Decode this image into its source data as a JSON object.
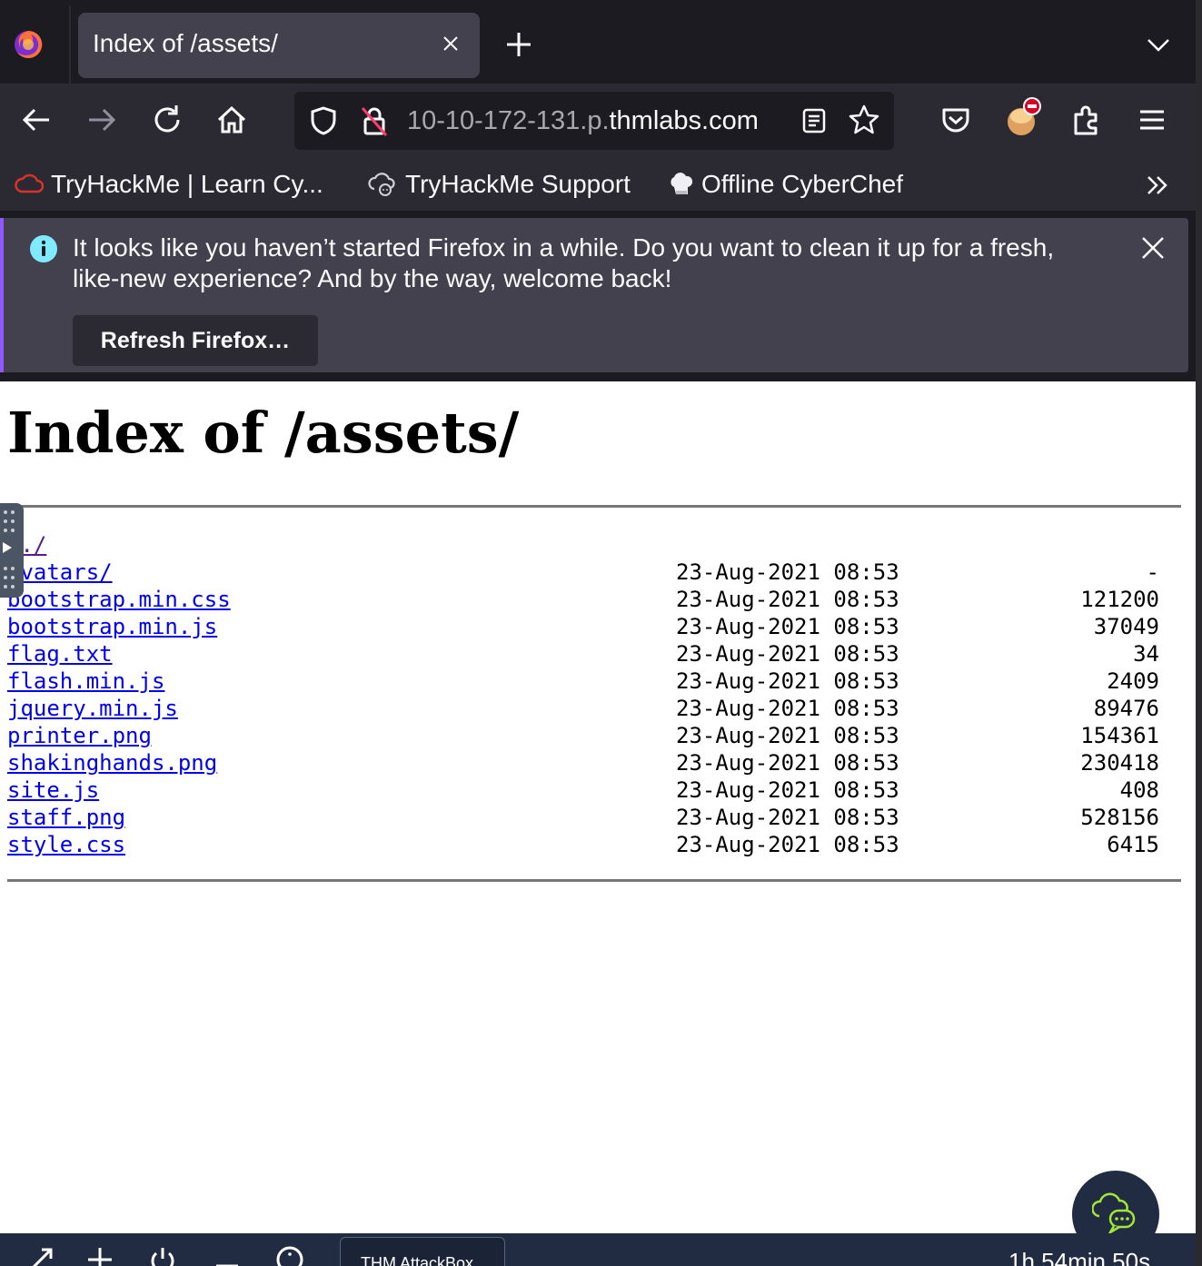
{
  "browser": {
    "tab_title": "Index of /assets/",
    "url_prefix": "10-10-172-131.p.",
    "url_domain": "thmlabs.com",
    "bookmarks": [
      {
        "label": "TryHackMe | Learn Cy..."
      },
      {
        "label": "TryHackMe Support"
      },
      {
        "label": "Offline CyberChef"
      }
    ],
    "notification": {
      "message": "It looks like you haven’t started Firefox in a while. Do you want to clean it up for a fresh, like-new experience? And by the way, welcome back!",
      "button": "Refresh Firefox…"
    }
  },
  "page": {
    "title": "Index of /assets/",
    "entries": [
      {
        "name": "../",
        "date": "",
        "size": ""
      },
      {
        "name": "avatars/",
        "date": "23-Aug-2021 08:53",
        "size": "-"
      },
      {
        "name": "bootstrap.min.css",
        "date": "23-Aug-2021 08:53",
        "size": "121200"
      },
      {
        "name": "bootstrap.min.js",
        "date": "23-Aug-2021 08:53",
        "size": "37049"
      },
      {
        "name": "flag.txt",
        "date": "23-Aug-2021 08:53",
        "size": "34"
      },
      {
        "name": "flash.min.js",
        "date": "23-Aug-2021 08:53",
        "size": "2409"
      },
      {
        "name": "jquery.min.js",
        "date": "23-Aug-2021 08:53",
        "size": "89476"
      },
      {
        "name": "printer.png",
        "date": "23-Aug-2021 08:53",
        "size": "154361"
      },
      {
        "name": "shakinghands.png",
        "date": "23-Aug-2021 08:53",
        "size": "230418"
      },
      {
        "name": "site.js",
        "date": "23-Aug-2021 08:53",
        "size": "408"
      },
      {
        "name": "staff.png",
        "date": "23-Aug-2021 08:53",
        "size": "528156"
      },
      {
        "name": "style.css",
        "date": "23-Aug-2021 08:53",
        "size": "6415"
      }
    ]
  },
  "taskbar": {
    "tab_label": "THM AttackBox",
    "timer": "1h 54min 50s"
  },
  "colors": {
    "link": "#0000ee",
    "visited_link": "#551a8b",
    "chrome_dark": "#1c1b22",
    "chrome_toolbar": "#2b2a33",
    "infobar": "#42414d",
    "taskbar": "#212c42"
  }
}
